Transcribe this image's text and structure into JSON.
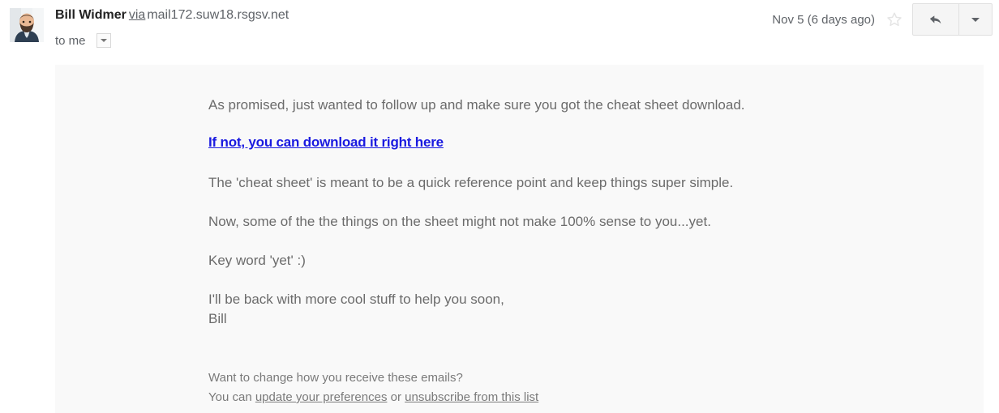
{
  "header": {
    "sender_name": "Bill Widmer",
    "via_label": "via",
    "sender_domain": "mail172.suw18.rsgsv.net",
    "recipient": "to me",
    "date": "Nov 5 (6 days ago)",
    "star_icon": "star-outline-icon",
    "reply_icon": "reply-arrow-icon",
    "more_icon": "chevron-down-icon",
    "recipient_caret_icon": "chevron-down-icon",
    "avatar_icon": "sender-avatar-photo"
  },
  "body": {
    "paragraph_1": "As promised, just wanted to follow up and make sure you got the cheat sheet download.",
    "cta_link": "If not, you can download it right here",
    "paragraph_2": "The 'cheat sheet' is meant to be a quick reference point and keep things super simple.",
    "paragraph_3": "Now, some of the the things on the sheet might not make 100% sense to you...yet.",
    "paragraph_4": "Key word 'yet' :)",
    "signoff_line_1": "I'll be back with more cool stuff to help you soon,",
    "signoff_line_2": "Bill"
  },
  "footer": {
    "question": "Want to change how you receive these emails?",
    "prefix": "You can ",
    "preferences_link": "update your preferences",
    "separator": " or ",
    "unsubscribe_link": "unsubscribe from this list"
  },
  "colors": {
    "link_blue": "#1a1ae0",
    "body_text": "#6b6b6b",
    "panel_background": "#f9f9f9",
    "page_background": "#ffffff"
  }
}
